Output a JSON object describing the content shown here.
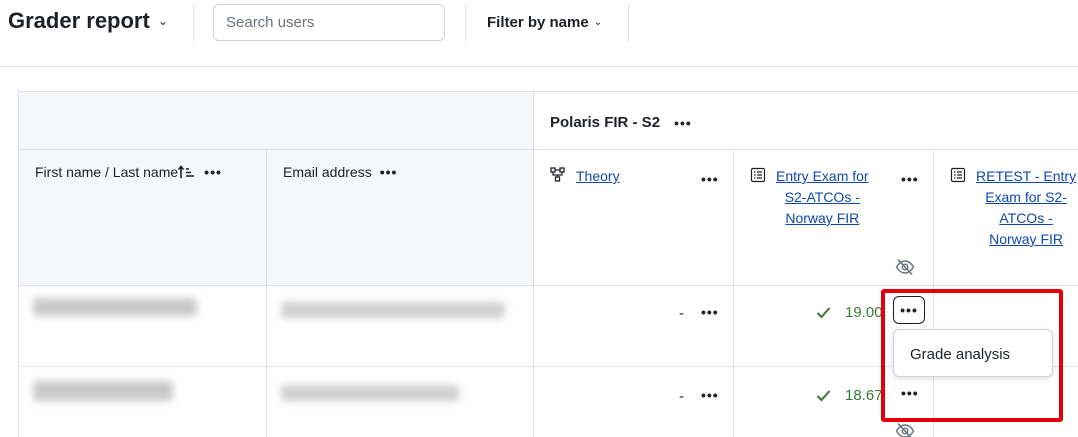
{
  "header": {
    "title": "Grader report",
    "search": {
      "placeholder": "Search users",
      "value": ""
    },
    "filter_label": "Filter by name"
  },
  "grid": {
    "category": {
      "title": "Polaris FIR - S2"
    },
    "columns": {
      "name": "First name / Last name",
      "email": "Email address",
      "items": [
        {
          "label": "Theory",
          "icon": "category-icon",
          "hidden": false
        },
        {
          "label": "Entry Exam for S2-ATCOs - Norway FIR",
          "label_lines": [
            "Entry Exam for",
            "S2-ATCOs -",
            "Norway FIR"
          ],
          "icon": "quiz-icon",
          "hidden": true
        },
        {
          "label": "RETEST - Entry Exam for S2-ATCOs - Norway FIR",
          "label_lines": [
            "RETEST - Entry",
            "Exam for S2-",
            "ATCOs -",
            "Norway FIR"
          ],
          "icon": "quiz-icon",
          "hidden": false
        }
      ]
    },
    "rows": [
      {
        "theory": "-",
        "entry_exam": "19.00",
        "entry_status": "passed"
      },
      {
        "theory": "-",
        "entry_exam": "18.67",
        "entry_status": "passed"
      }
    ]
  },
  "action_menu": {
    "items": [
      "Grade analysis"
    ]
  },
  "colors": {
    "link": "#0f47ad",
    "pass": "#357a32",
    "highlight": "#e3000b",
    "header_bg": "#f5f7f9"
  }
}
